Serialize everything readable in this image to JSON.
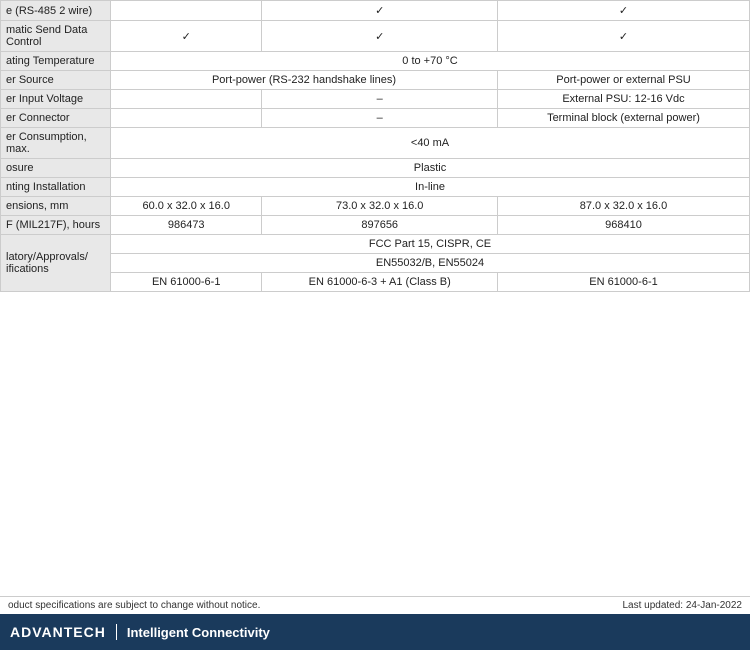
{
  "table": {
    "rows": [
      {
        "label": "e (RS-485 2 wire)",
        "col1": "",
        "col2": "✓",
        "col3": "✓",
        "type": "check_row",
        "col1_check": false,
        "col2_check": true,
        "col3_check": true
      },
      {
        "label": "matic Send Data Control",
        "col1": "✓",
        "col2": "✓",
        "col3": "✓",
        "type": "check_row",
        "col1_check": true,
        "col2_check": true,
        "col3_check": true
      },
      {
        "label": "ating Temperature",
        "col_span": "0 to +70 °C",
        "type": "span_row"
      },
      {
        "label": "er Source",
        "col1": "Port-power (RS-232 handshake lines)",
        "col2": "",
        "col3": "Port-power or external PSU",
        "type": "source_row"
      },
      {
        "label": "er Input Voltage",
        "col1": "",
        "col2": "–",
        "col3": "External PSU: 12-16 Vdc",
        "type": "voltage_row"
      },
      {
        "label": "er Connector",
        "col1": "",
        "col2": "–",
        "col3": "Terminal block (external power)",
        "type": "connector_row"
      },
      {
        "label": "er Consumption, max.",
        "col_span": "<40 mA",
        "type": "span_row"
      },
      {
        "label": "osure",
        "col_span": "Plastic",
        "type": "span_row"
      },
      {
        "label": "nting Installation",
        "col_span": "In-line",
        "type": "span_row"
      },
      {
        "label": "ensions, mm",
        "col1": "60.0 x 32.0 x 16.0",
        "col2": "73.0 x 32.0 x 16.0",
        "col3": "87.0 x 32.0 x 16.0",
        "type": "three_col"
      },
      {
        "label": "F (MIL217F), hours",
        "col1": "986473",
        "col2": "897656",
        "col3": "968410",
        "type": "three_col"
      },
      {
        "label": "latory/Approvals/\nifications",
        "col_span": "FCC Part 15, CISPR, CE",
        "col_span2": "EN55032/B, EN55024",
        "col1": "EN 61000-6-1",
        "col2": "EN 61000-6-3 + A1 (Class B)",
        "col3": "EN 61000-6-1",
        "type": "approvals_row"
      }
    ]
  },
  "footer": {
    "logo": "ADVANTECH",
    "tagline": "Intelligent Connectivity",
    "notice": "oduct specifications are subject to change without notice.",
    "updated": "Last updated: 24-Jan-2022"
  }
}
